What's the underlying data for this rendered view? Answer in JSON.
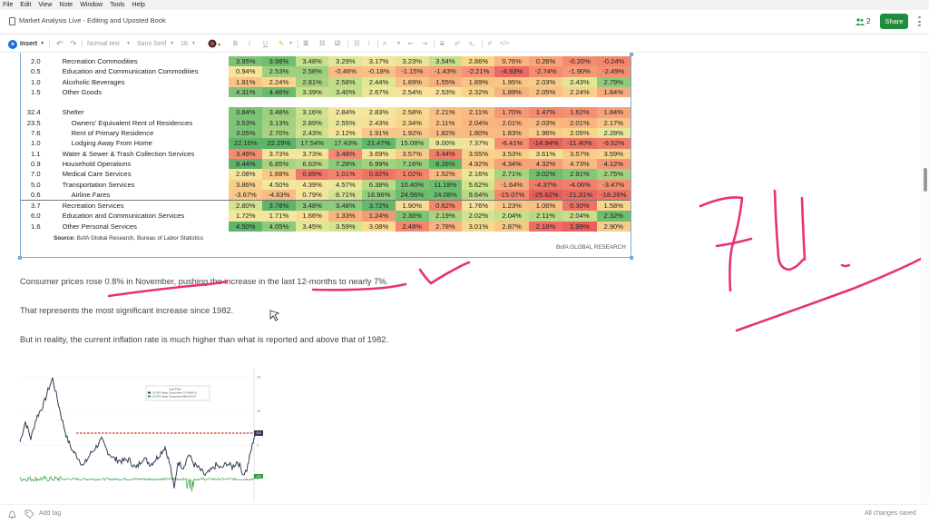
{
  "menu": [
    "File",
    "Edit",
    "View",
    "Note",
    "Window",
    "Tools",
    "Help"
  ],
  "window": {
    "title": "Market Analysis Live - Editing and Uposted Book",
    "collaborators": "2",
    "share_label": "Share"
  },
  "toolbar": {
    "insert_label": "Insert",
    "style_label": "Normal text",
    "font_label": "Sans Serif",
    "size_label": "16"
  },
  "table": {
    "rows": [
      {
        "w": "2.0",
        "label": "Recreation Commodities",
        "indent": 0,
        "vals": [
          "3.95%",
          "3.98%",
          "3.48%",
          "3.29%",
          "3.17%",
          "3.23%",
          "3.54%",
          "2.86%",
          "0.76%",
          "0.26%",
          "-0.20%",
          "-0.24%"
        ],
        "colors": [
          "#7dc275",
          "#6fbd6f",
          "#c6e08a",
          "#dfe89a",
          "#f0e599",
          "#e8e597",
          "#c6df8a",
          "#f8d68a",
          "#f9b480",
          "#f8a378",
          "#f48b6e",
          "#f2876c"
        ]
      },
      {
        "w": "0.5",
        "label": "Education and Communication Commodities",
        "indent": 0,
        "vals": [
          "0.94%",
          "2.53%",
          "2.58%",
          "-0.46%",
          "-0.18%",
          "-1.15%",
          "-1.43%",
          "-2.21%",
          "-4.93%",
          "-2.74%",
          "-1.90%",
          "-2.49%"
        ],
        "colors": [
          "#f7e599",
          "#9ccf7e",
          "#9ccf7e",
          "#f9bd84",
          "#f9c185",
          "#f7a87a",
          "#f6a279",
          "#f59275",
          "#e96a63",
          "#f58c71",
          "#f59a76",
          "#f48f73"
        ]
      },
      {
        "w": "1.0",
        "label": "Alcoholic Beverages",
        "indent": 0,
        "vals": [
          "1.91%",
          "2.24%",
          "2.81%",
          "2.58%",
          "2.44%",
          "1.89%",
          "1.55%",
          "1.89%",
          "1.95%",
          "2.03%",
          "2.43%",
          "2.79%"
        ],
        "colors": [
          "#f8c486",
          "#f9d68c",
          "#a6d280",
          "#c2dd88",
          "#dfe694",
          "#f8c486",
          "#f7b180",
          "#f8c486",
          "#f8c787",
          "#f9cb88",
          "#e2e795",
          "#8fca7b"
        ]
      },
      {
        "w": "1.5",
        "label": "Other Goods",
        "indent": 0,
        "vals": [
          "4.31%",
          "4.46%",
          "3.39%",
          "3.40%",
          "2.67%",
          "2.54%",
          "2.53%",
          "2.32%",
          "1.89%",
          "2.05%",
          "2.24%",
          "1.84%"
        ],
        "colors": [
          "#7fc277",
          "#6dba6e",
          "#c7e08b",
          "#c4df8a",
          "#f0e69b",
          "#f7e29a",
          "#f8e19a",
          "#f9d38b",
          "#f8b180",
          "#f9c185",
          "#f9cf8a",
          "#f6ac7d"
        ]
      },
      {
        "gap": true
      },
      {
        "w": "32.4",
        "label": "Shelter",
        "indent": 0,
        "vals": [
          "3.84%",
          "3.48%",
          "3.16%",
          "2.84%",
          "2.83%",
          "2.58%",
          "2.21%",
          "2.11%",
          "1.70%",
          "1.47%",
          "1.62%",
          "1.84%"
        ],
        "colors": [
          "#7dc275",
          "#9ccf7e",
          "#cfe28f",
          "#f2e79c",
          "#f2e79c",
          "#f9d98d",
          "#f8c186",
          "#f8bb84",
          "#f59876",
          "#f38a70",
          "#f49173",
          "#f6a17a"
        ]
      },
      {
        "w": "23.5",
        "label": "Owners' Equivalent Rent of Residences",
        "indent": 1,
        "vals": [
          "3.53%",
          "3.13%",
          "2.89%",
          "2.55%",
          "2.43%",
          "2.34%",
          "2.11%",
          "2.04%",
          "2.01%",
          "2.03%",
          "2.01%",
          "2.17%"
        ],
        "colors": [
          "#7dc275",
          "#a2d17f",
          "#c6df8a",
          "#eae79a",
          "#f7e09a",
          "#f9d68c",
          "#f9c185",
          "#f8b781",
          "#f8b480",
          "#f8b781",
          "#f8b480",
          "#f9c485"
        ]
      },
      {
        "w": "7.6",
        "label": "Rent of Primary Residence",
        "indent": 1,
        "vals": [
          "3.05%",
          "2.70%",
          "2.43%",
          "2.12%",
          "1.91%",
          "1.92%",
          "1.82%",
          "1.80%",
          "1.83%",
          "1.96%",
          "2.05%",
          "2.28%"
        ],
        "colors": [
          "#7dc275",
          "#a9d381",
          "#cfe28f",
          "#f6e29b",
          "#f9c787",
          "#f9c787",
          "#f8ba84",
          "#f8b983",
          "#f8bb84",
          "#f9ca88",
          "#f9d58b",
          "#e7e69a"
        ]
      },
      {
        "w": "1.0",
        "label": "Lodging Away From Home",
        "indent": 1,
        "vals": [
          "22.16%",
          "22.29%",
          "17.54%",
          "17.43%",
          "21.47%",
          "15.08%",
          "9.00%",
          "7.37%",
          "-6.41%",
          "-14.94%",
          "-11.40%",
          "-9.52%"
        ],
        "colors": [
          "#5fb46a",
          "#5db369",
          "#8ac879",
          "#8ac879",
          "#66b76c",
          "#a9d381",
          "#e6e799",
          "#f3e39a",
          "#f58e72",
          "#e4655f",
          "#ea7265",
          "#ee7c69"
        ]
      },
      {
        "w": "1.1",
        "label": "Water & Sewer & Trash Collection Services",
        "indent": 0,
        "vals": [
          "3.49%",
          "3.73%",
          "3.73%",
          "3.48%",
          "3.69%",
          "3.57%",
          "3.44%",
          "3.55%",
          "3.53%",
          "3.61%",
          "3.57%",
          "3.59%"
        ],
        "colors": [
          "#f48d72",
          "#f3e59b",
          "#f3e59b",
          "#f38a70",
          "#f5e59b",
          "#f9cb89",
          "#f27f6b",
          "#f9d08a",
          "#f9ce8a",
          "#f8dd95",
          "#f9cb89",
          "#f9d38b"
        ]
      },
      {
        "w": "0.9",
        "label": "Household Operations",
        "indent": 0,
        "vals": [
          "8.44%",
          "6.85%",
          "6.63%",
          "7.28%",
          "6.99%",
          "7.16%",
          "8.26%",
          "4.92%",
          "4.34%",
          "4.32%",
          "4.73%",
          "4.12%"
        ],
        "colors": [
          "#5db369",
          "#a9d381",
          "#b9d986",
          "#8dca7b",
          "#a2d17f",
          "#97cd7d",
          "#66b76c",
          "#f8c888",
          "#f5a27a",
          "#f5a27a",
          "#f8b982",
          "#f39675"
        ]
      },
      {
        "w": "7.0",
        "label": "Medical Care Services",
        "indent": 0,
        "vals": [
          "2.08%",
          "1.68%",
          "0.89%",
          "1.01%",
          "0.82%",
          "1.02%",
          "1.52%",
          "2.16%",
          "2.71%",
          "3.02%",
          "2.91%",
          "2.75%"
        ],
        "colors": [
          "#f3e59b",
          "#f9c787",
          "#f0756a",
          "#f4836e",
          "#ef7369",
          "#f4836e",
          "#f8b982",
          "#eae79a",
          "#a9d381",
          "#72be71",
          "#87c678",
          "#a2d17f"
        ]
      },
      {
        "w": "5.0",
        "label": "Transportation Services",
        "indent": 0,
        "vals": [
          "3.86%",
          "4.50%",
          "4.39%",
          "4.57%",
          "6.38%",
          "10.40%",
          "11.18%",
          "5.62%",
          "-1.64%",
          "-4.37%",
          "-4.06%",
          "-3.47%"
        ],
        "colors": [
          "#f9d08a",
          "#f2e79c",
          "#f5e59b",
          "#eae79a",
          "#b9d986",
          "#79c173",
          "#6ebd6f",
          "#d6e491",
          "#f7ac7d",
          "#ef7a69",
          "#f0806b",
          "#f3906f"
        ]
      },
      {
        "w": "0.6",
        "label": "Airline Fares",
        "indent": 1,
        "vals": [
          "-3.67%",
          "-4.63%",
          "0.79%",
          "6.71%",
          "18.96%",
          "24.56%",
          "24.08%",
          "9.64%",
          "-15.07%",
          "-25.62%",
          "-21.31%",
          "-18.26%"
        ],
        "colors": [
          "#f9c888",
          "#f8bc84",
          "#f4e49b",
          "#d3e390",
          "#92cc7c",
          "#6dba6e",
          "#6fbd6f",
          "#b9d986",
          "#f2876c",
          "#e4605d",
          "#e8695f",
          "#ec7466"
        ]
      },
      {
        "w": "3.7",
        "label": "Recreation Services",
        "indent": 0,
        "top": true,
        "vals": [
          "2.80%",
          "3.78%",
          "3.48%",
          "3.48%",
          "3.72%",
          "1.90%",
          "0.62%",
          "1.76%",
          "1.23%",
          "1.06%",
          "0.30%",
          "1.58%"
        ],
        "colors": [
          "#d3e390",
          "#5fb46a",
          "#8dca7b",
          "#8dca7b",
          "#66b76c",
          "#f8dc94",
          "#f18a6d",
          "#f8e19a",
          "#f8c686",
          "#f8c083",
          "#ef7369",
          "#f9d78c"
        ]
      },
      {
        "w": "6.0",
        "label": "Education and Communication Services",
        "indent": 0,
        "vals": [
          "1.72%",
          "1.71%",
          "1.66%",
          "1.33%",
          "1.24%",
          "2.36%",
          "2.19%",
          "2.02%",
          "2.04%",
          "2.11%",
          "2.04%",
          "2.32%"
        ],
        "colors": [
          "#f2e79c",
          "#f2e79c",
          "#f9dd95",
          "#f7b480",
          "#f39b76",
          "#7dc275",
          "#a9d381",
          "#d3e390",
          "#c6df8a",
          "#b9d986",
          "#c6df8a",
          "#6fbd6f"
        ]
      },
      {
        "w": "1.6",
        "label": "Other Personal Services",
        "indent": 0,
        "vals": [
          "4.50%",
          "4.05%",
          "3.45%",
          "3.59%",
          "3.08%",
          "2.48%",
          "2.78%",
          "3.01%",
          "2.87%",
          "2.18%",
          "1.99%",
          "2.90%"
        ],
        "colors": [
          "#5fb46a",
          "#8dca7b",
          "#e2e795",
          "#d3e390",
          "#f9db91",
          "#f4856f",
          "#f8b280",
          "#f9d78c",
          "#f8c787",
          "#f06c67",
          "#ea5f5d",
          "#f8cb88"
        ]
      }
    ],
    "source_label": "Source:",
    "source_text": "BofA Global Research, Bureau of Labor Statistics",
    "bofa_label": "BofA GLOBAL RESEARCH"
  },
  "paragraphs": [
    "Consumer prices rose 0.8% in November, pushing the increase in the last 12-months to nearly 7%.",
    "That represents the most significant increase since 1982.",
    "But in reality, the current inflation rate is much higher than what is reported and above that of 1982."
  ],
  "line_chart": {
    "legend_title": "Last Price",
    "legend_items": [
      "US CPI Urban Consumers Y/Y NSA 6.8",
      "US CPI Urban Consumers M/M SA 0.8"
    ],
    "right_ticks": [
      "15",
      "10",
      "5",
      "0"
    ],
    "last_value_badge": "6.8",
    "last_mom_badge": "0.8",
    "colors": {
      "yoy": "#2f3a56",
      "mom": "#2a9d3a",
      "ref": "#d33a2f"
    }
  },
  "status": {
    "add_tag": "Add tag",
    "saved": "All changes saved"
  }
}
